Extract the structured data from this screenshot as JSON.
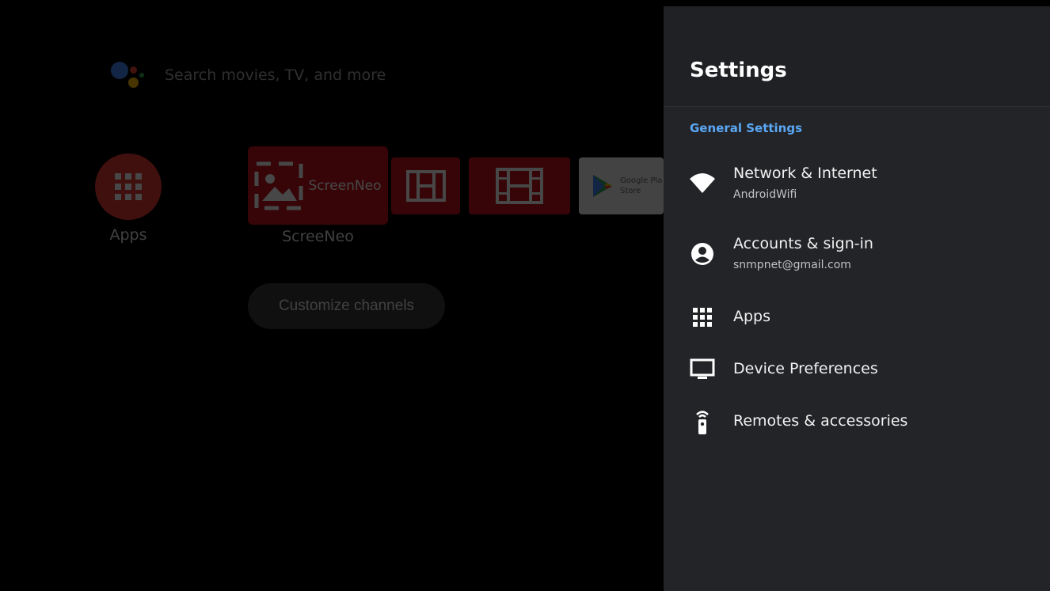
{
  "home": {
    "search_placeholder": "Search movies, TV, and more",
    "apps_label": "Apps",
    "focused_tile": {
      "logo_text": "ScreenNeo",
      "label": "ScreeNeo"
    },
    "google_play": {
      "line1": "Google Pla",
      "line2": "Store"
    },
    "customize_channels": "Customize channels"
  },
  "settings": {
    "title": "Settings",
    "section": "General Settings",
    "items": [
      {
        "label": "Network & Internet",
        "sub": "AndroidWifi",
        "icon": "wifi-icon"
      },
      {
        "label": "Accounts & sign-in",
        "sub": "snmpnet@gmail.com",
        "icon": "account-icon"
      },
      {
        "label": "Apps",
        "icon": "apps-grid-icon"
      },
      {
        "label": "Device Preferences",
        "icon": "tv-icon"
      },
      {
        "label": "Remotes & accessories",
        "icon": "remote-icon"
      }
    ]
  },
  "colors": {
    "accent": "#5aa8f5",
    "panel_bg": "#232428",
    "tile_red": "#c7141a"
  }
}
